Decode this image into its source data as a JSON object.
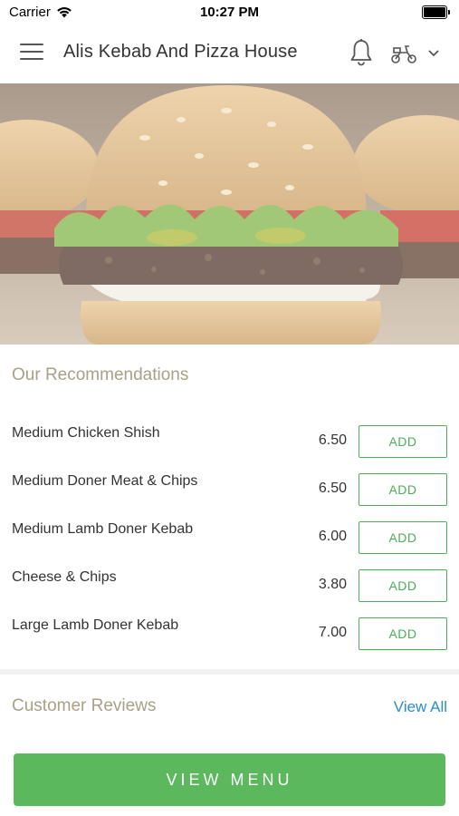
{
  "status_bar": {
    "carrier": "Carrier",
    "time": "10:27 PM"
  },
  "header": {
    "title": "Alis Kebab And Pizza House",
    "icons": [
      "menu-icon",
      "bell-icon",
      "scooter-icon",
      "chevron-down-icon"
    ]
  },
  "recommendations": {
    "title": "Our Recommendations",
    "items": [
      {
        "name": "Medium Chicken Shish",
        "price": "6.50",
        "add_label": "ADD"
      },
      {
        "name": "Medium Doner Meat & Chips",
        "price": "6.50",
        "add_label": "ADD"
      },
      {
        "name": "Medium Lamb Doner Kebab",
        "price": "6.00",
        "add_label": "ADD"
      },
      {
        "name": "Cheese & Chips",
        "price": "3.80",
        "add_label": "ADD"
      },
      {
        "name": "Large Lamb Doner Kebab",
        "price": "7.00",
        "add_label": "ADD"
      }
    ]
  },
  "reviews": {
    "title": "Customer Reviews",
    "view_all_label": "View All"
  },
  "footer": {
    "view_menu_label": "VIEW MENU"
  },
  "colors": {
    "accent_green": "#5cb85c",
    "add_border": "#4cae5a",
    "link_blue": "#2a8fc7",
    "section_title": "#a8a088"
  }
}
